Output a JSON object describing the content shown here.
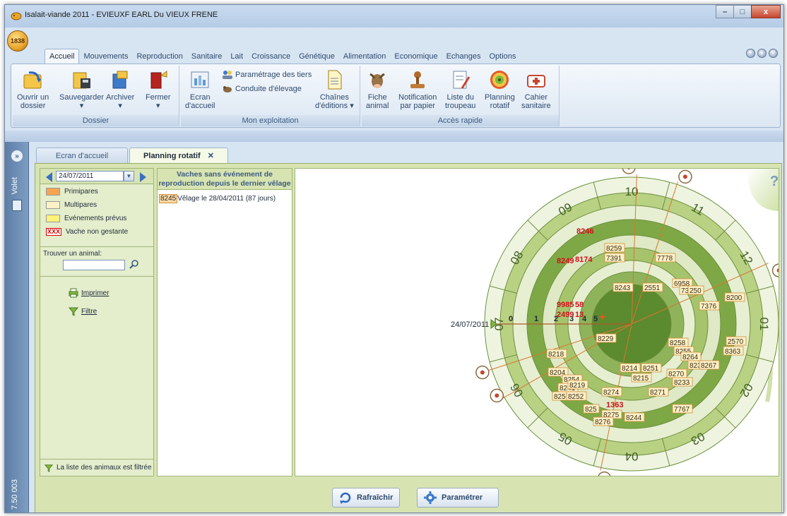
{
  "window": {
    "title": "Isalait-viande 2011 - EVIEUXF EARL Du VIEUX FRENE",
    "minimize": "–",
    "maximize": "□",
    "close": "x"
  },
  "app_orb": "1838",
  "ribbon_tabs": [
    "Accueil",
    "Mouvements",
    "Reproduction",
    "Sanitaire",
    "Lait",
    "Croissance",
    "Génétique",
    "Alimentation",
    "Economique",
    "Echanges",
    "Options"
  ],
  "ribbon": {
    "dossier": {
      "label": "Dossier",
      "ouvrir": "Ouvrir un",
      "ouvrir2": "dossier",
      "sauvegarder": "Sauvegarder",
      "archiver": "Archiver",
      "fermer": "Fermer"
    },
    "exploitation": {
      "label": "Mon exploitation",
      "ecran": "Ecran",
      "ecran2": "d'accueil",
      "parametrage": "Paramétrage des tiers",
      "conduite": "Conduite d'élevage",
      "chaines": "Chaînes",
      "chaines2": "d'éditions ▾"
    },
    "acces": {
      "label": "Accès rapide",
      "fiche": "Fiche",
      "fiche2": "animal",
      "notif": "Notification",
      "notif2": "par papier",
      "liste": "Liste du",
      "liste2": "troupeau",
      "planning": "Planning",
      "planning2": "rotatif",
      "cahier": "Cahier",
      "cahier2": "sanitaire"
    }
  },
  "volet": {
    "label": "Volet",
    "version": "7.50 003"
  },
  "doc_tabs": {
    "tab1": "Ecran d'accueil",
    "tab2": "Planning rotatif",
    "close": "✕"
  },
  "left": {
    "date": "24/07/2011",
    "legend": [
      {
        "label": "Primipares",
        "color": "#f5a552"
      },
      {
        "label": "Multipares",
        "color": "#fdf1c8"
      },
      {
        "label": "Evénements prévus",
        "color": "#fff27a"
      },
      {
        "label": "Vache non gestante",
        "xxx": "XXX"
      }
    ],
    "find_label": "Trouver un animal:",
    "imprimer": "Imprimer",
    "filtre": "Filtre",
    "filter_note": "La liste des animaux est filtrée"
  },
  "middle": {
    "header": "Vaches sans événement de reproduction depuis le dernier vêlage",
    "rows": [
      {
        "id": "8245",
        "text": "Vêlage le 28/04/2011 (87 jours)"
      }
    ]
  },
  "chart": {
    "current_date": "24/07/2011",
    "help": "?",
    "months": [
      "10",
      "11",
      "12",
      "01",
      "02",
      "03",
      "04",
      "05",
      "06",
      "07",
      "08",
      "09"
    ],
    "ring_numbers": [
      "0",
      "1",
      "2",
      "3",
      "4",
      "5"
    ],
    "labels_red": [
      "8246",
      "8249",
      "8174",
      "9985",
      "58",
      "2499",
      "13",
      "1363"
    ],
    "labels_tan": [
      "8259",
      "7391",
      "7778",
      "8243",
      "2551",
      "6958",
      "7387",
      "250",
      "8200",
      "7376",
      "8229",
      "8218",
      "8204",
      "8254",
      "8241",
      "8257",
      "8219",
      "8252",
      "8274",
      "825",
      "8275",
      "8276",
      "8244",
      "8214",
      "8215",
      "8251",
      "8270",
      "8233",
      "8271",
      "7767",
      "8258",
      "8255",
      "8264",
      "823",
      "8267",
      "8363",
      "2570"
    ]
  },
  "buttons": {
    "rafraichir": "Rafraîchir",
    "parametrer": "Paramétrer"
  }
}
